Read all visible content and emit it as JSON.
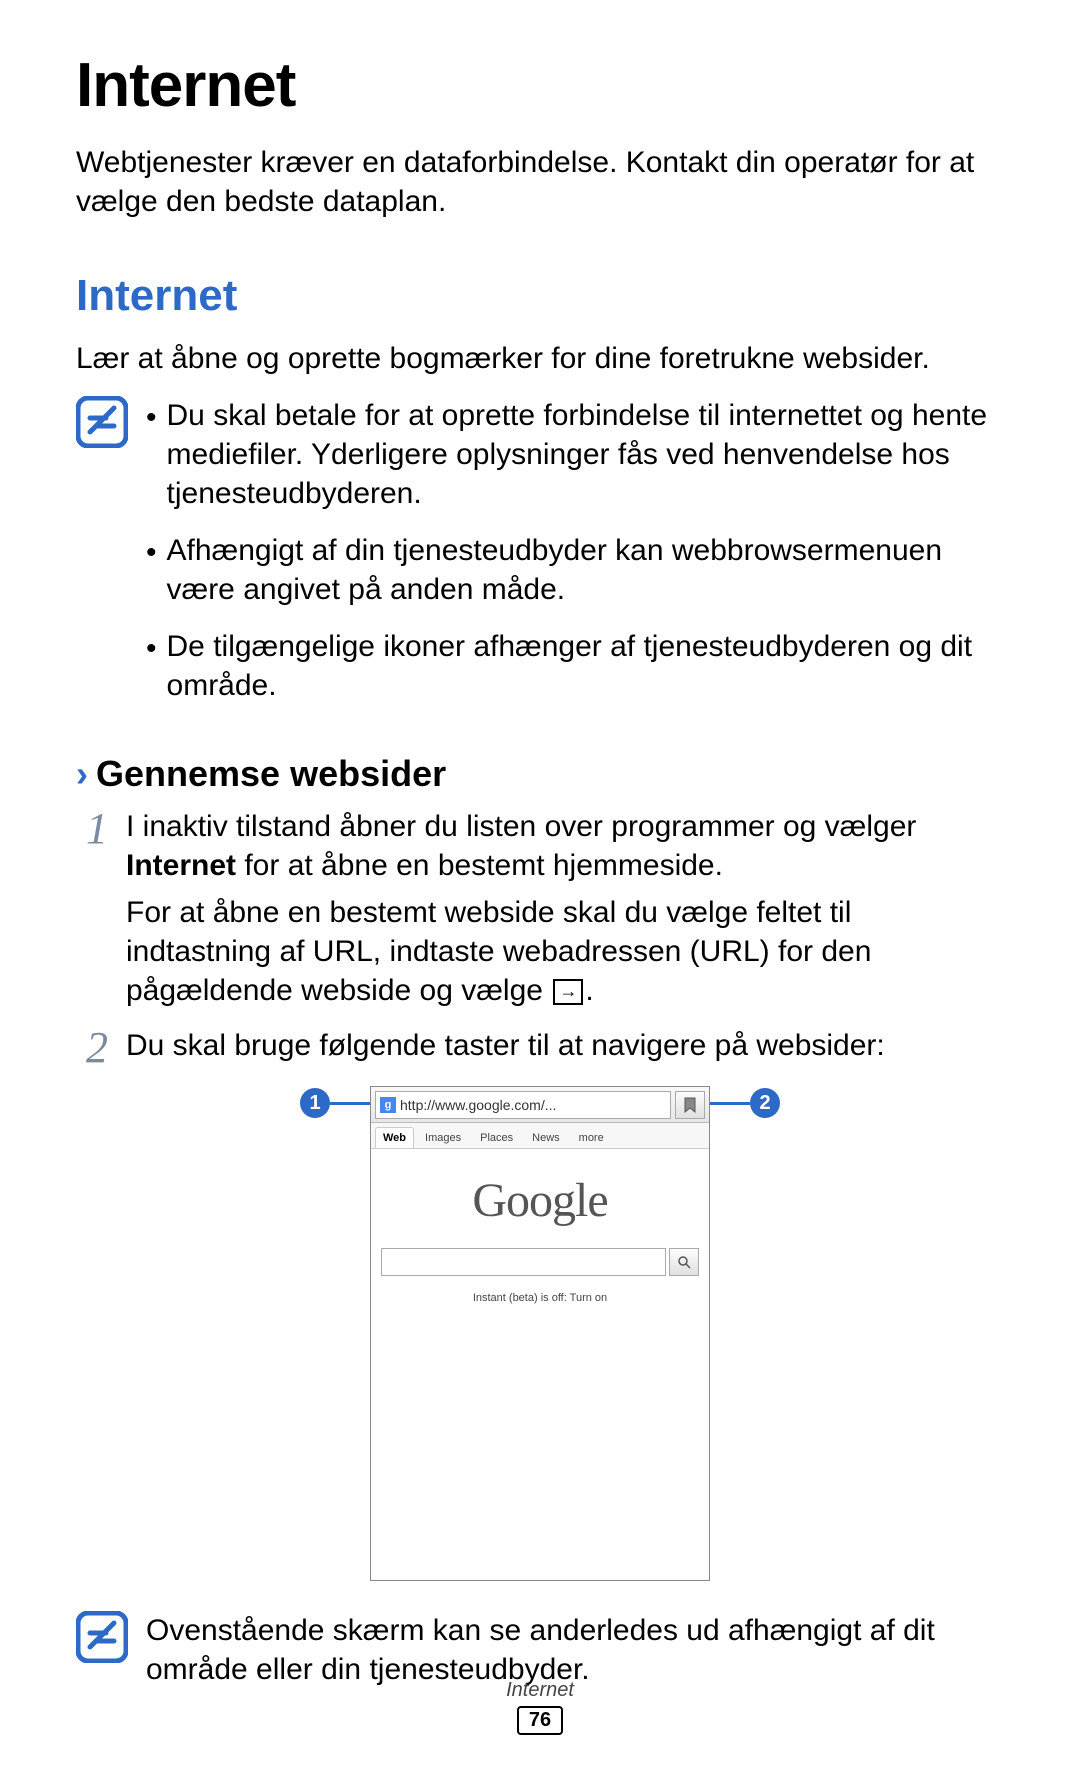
{
  "title": "Internet",
  "intro": "Webtjenester kræver en dataforbindelse. Kontakt din operatør for at vælge den bedste dataplan.",
  "section": {
    "title": "Internet",
    "intro": "Lær at åbne og oprette bogmærker for dine foretrukne websider.",
    "notes": [
      "Du skal betale for at oprette forbindelse til internettet og hente mediefiler. Yderligere oplysninger fås ved henvendelse hos tjenesteudbyderen.",
      "Afhængigt af din tjenesteudbyder kan webbrowsermenuen være angivet på anden måde.",
      "De tilgængelige ikoner afhænger af tjenesteudbyderen og dit område."
    ]
  },
  "subsection": {
    "title": "Gennemse websider"
  },
  "steps": {
    "num1": "1",
    "num2": "2",
    "step1_a": "I inaktiv tilstand åbner du listen over programmer og vælger ",
    "step1_bold": "Internet",
    "step1_b": " for at åbne en bestemt hjemmeside.",
    "step1_p2a": "For at åbne en bestemt webside skal du vælge feltet til indtastning af URL, indtaste webadressen (URL) for den pågældende webside og vælge ",
    "step1_p2b": ".",
    "step2": "Du skal bruge følgende taster til at navigere på websider:"
  },
  "screenshot": {
    "url": "http://www.google.com/...",
    "favicon_letter": "g",
    "tabs": [
      "Web",
      "Images",
      "Places",
      "News",
      "more"
    ],
    "logo": "Google",
    "instant": "Instant (beta) is off: Turn on",
    "callout1": "1",
    "callout2": "2",
    "search_arrow": "→"
  },
  "footer_note": "Ovenstående skærm kan se anderledes ud afhængigt af dit område eller din tjenesteudbyder.",
  "footer": {
    "label": "Internet",
    "page": "76"
  },
  "bullet": "•",
  "chevron": "›"
}
